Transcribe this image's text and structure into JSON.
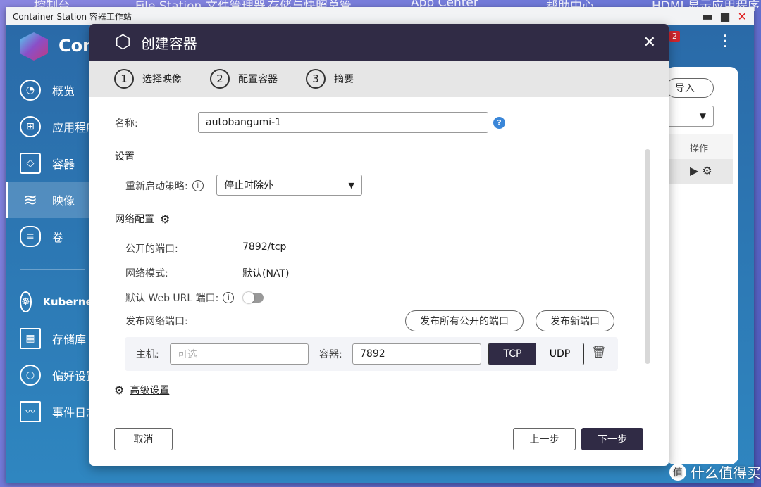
{
  "desktop": {
    "icons": [
      "控制台",
      "File Station 文件管理器",
      "存储与快照总管",
      "App Center",
      "帮助中心",
      "HDMI 显示应用程序"
    ]
  },
  "window": {
    "title": "Container Station 容器工作站",
    "minimize": "▬",
    "maximize": "■",
    "close": "✕"
  },
  "app": {
    "name": "Container Station",
    "notification_count": "2",
    "more": "⋮",
    "sidebar": [
      {
        "label": "概览",
        "icon": "gauge-icon"
      },
      {
        "label": "应用程序",
        "icon": "apps-icon"
      },
      {
        "label": "容器",
        "icon": "cube-icon"
      },
      {
        "label": "映像",
        "icon": "layers-icon",
        "active": true
      },
      {
        "label": "卷",
        "icon": "database-icon"
      },
      {
        "label": "Kubernetes",
        "icon": "helm-icon"
      },
      {
        "label": "存储库",
        "icon": "repository-icon"
      },
      {
        "label": "偏好设置",
        "icon": "settings-icon"
      },
      {
        "label": "事件日志",
        "icon": "log-icon"
      }
    ],
    "right_panel": {
      "import": "导入",
      "column_actions": "操作"
    }
  },
  "modal": {
    "title": "创建容器",
    "close": "✕",
    "steps": [
      {
        "n": "1",
        "label": "选择映像"
      },
      {
        "n": "2",
        "label": "配置容器",
        "active": true
      },
      {
        "n": "3",
        "label": "摘要"
      }
    ],
    "name_label": "名称:",
    "name_value": "autobangumi-1",
    "settings_heading": "设置",
    "restart_label": "重新启动策略:",
    "restart_value": "停止时除外",
    "network_heading": "网络配置",
    "exposed_port_label": "公开的端口:",
    "exposed_port_value": "7892/tcp",
    "network_mode_label": "网络模式:",
    "network_mode_value": "默认(NAT)",
    "web_url_label": "默认 Web URL 端口:",
    "web_url_enabled": false,
    "publish_label": "发布网络端口:",
    "publish_all": "发布所有公开的端口",
    "publish_new": "发布新端口",
    "port_row": {
      "host_label": "主机:",
      "host_placeholder": "可选",
      "container_label": "容器:",
      "container_value": "7892",
      "protocols": [
        "TCP",
        "UDP"
      ],
      "selected": "TCP"
    },
    "advanced": "高级设置",
    "cancel": "取消",
    "back": "上一步",
    "next": "下一步"
  },
  "watermark": "什么值得买",
  "watermark_badge": "值"
}
